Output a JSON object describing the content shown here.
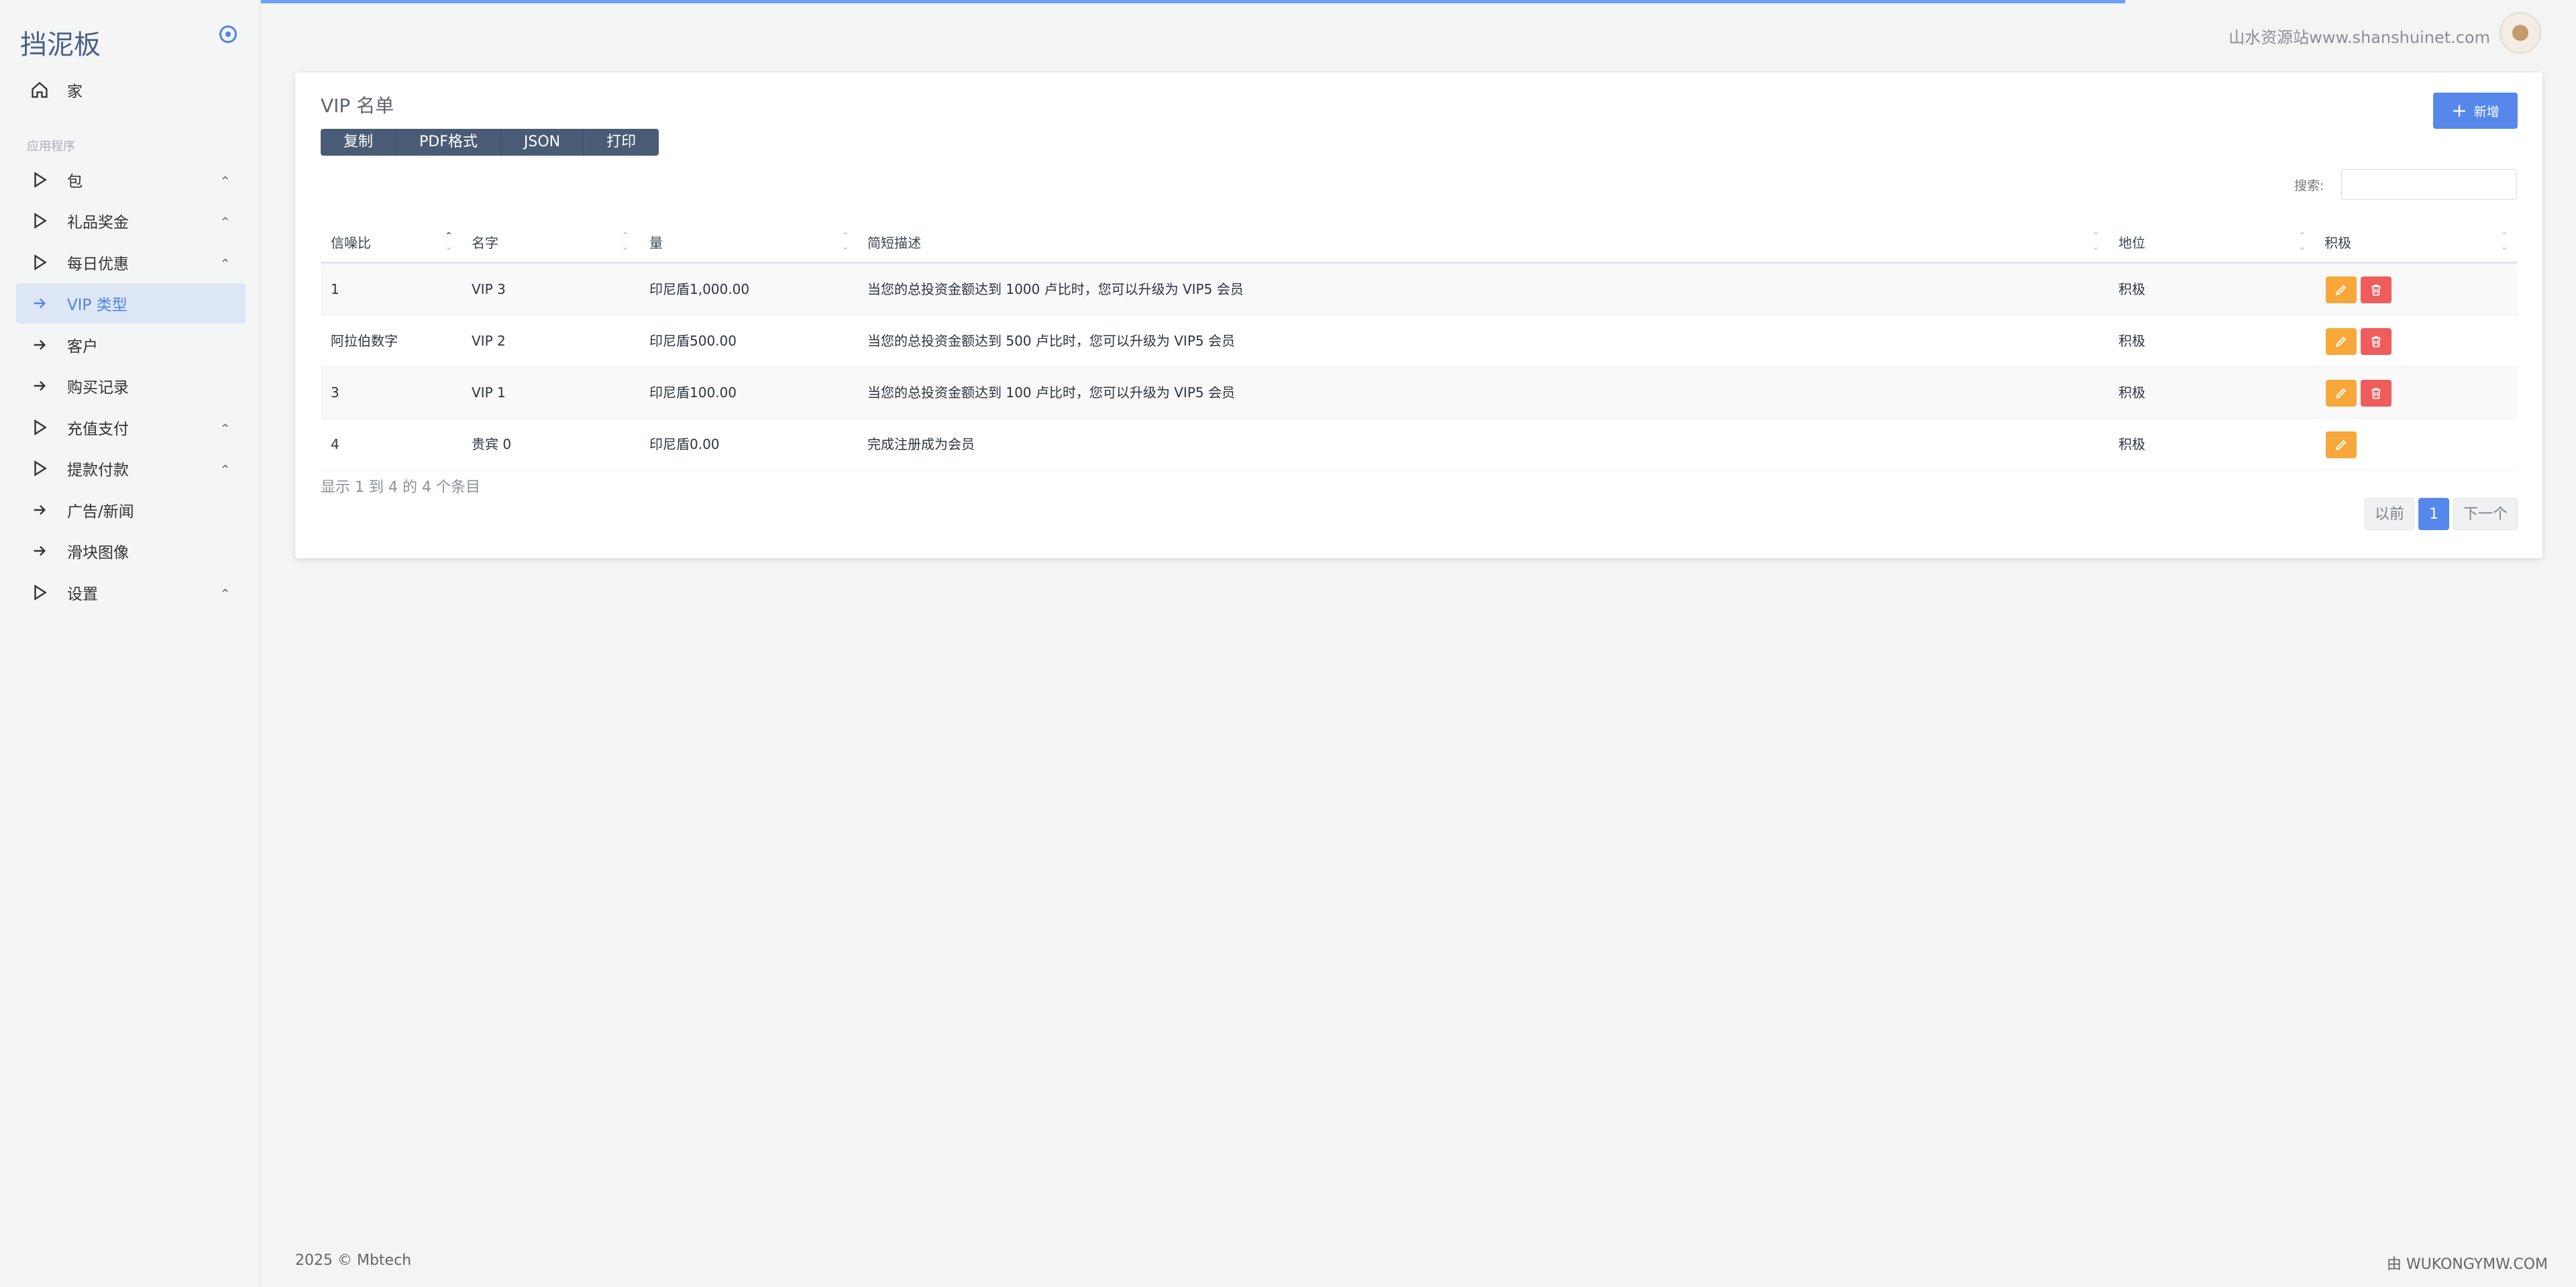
{
  "brand": "挡泥板",
  "sidebar": {
    "section_label": "应用程序",
    "items": [
      {
        "label": "家",
        "icon": "home-icon"
      },
      {
        "label": "包",
        "icon": "play-icon",
        "chevron": true
      },
      {
        "label": "礼品奖金",
        "icon": "play-icon",
        "chevron": true
      },
      {
        "label": "每日优惠",
        "icon": "play-icon",
        "chevron": true
      },
      {
        "label": "VIP 类型",
        "icon": "arrow-right-icon",
        "active": true
      },
      {
        "label": "客户",
        "icon": "arrow-right-icon"
      },
      {
        "label": "购买记录",
        "icon": "arrow-right-icon"
      },
      {
        "label": "充值支付",
        "icon": "play-icon",
        "chevron": true
      },
      {
        "label": "提款付款",
        "icon": "play-icon",
        "chevron": true
      },
      {
        "label": "广告/新闻",
        "icon": "arrow-right-icon"
      },
      {
        "label": "滑块图像",
        "icon": "arrow-right-icon"
      },
      {
        "label": "设置",
        "icon": "play-icon",
        "chevron": true
      }
    ]
  },
  "header": {
    "site_name": "山水资源站www.shanshuinet.com",
    "progress": 0.825
  },
  "card": {
    "title": "VIP 名单",
    "export_buttons": [
      "复制",
      "PDF格式",
      "JSON",
      "打印"
    ],
    "add_label": "新增",
    "search_label": "搜索:",
    "search_value": ""
  },
  "table": {
    "columns": [
      "信噪比",
      "名字",
      "量",
      "简短描述",
      "地位",
      "积极"
    ],
    "rows": [
      {
        "id": "1",
        "name": "VIP 3",
        "amount": "印尼盾1,000.00",
        "desc": "当您的总投资金额达到 1000 卢比时，您可以升级为 VIP5 会员",
        "status": "积极",
        "deletable": true
      },
      {
        "id": "阿拉伯数字",
        "name": "VIP 2",
        "amount": "印尼盾500.00",
        "desc": "当您的总投资金额达到 500 卢比时，您可以升级为 VIP5 会员",
        "status": "积极",
        "deletable": true
      },
      {
        "id": "3",
        "name": "VIP 1",
        "amount": "印尼盾100.00",
        "desc": "当您的总投资金额达到 100 卢比时，您可以升级为 VIP5 会员",
        "status": "积极",
        "deletable": true
      },
      {
        "id": "4",
        "name": "贵宾 0",
        "amount": "印尼盾0.00",
        "desc": "完成注册成为会员",
        "status": "积极",
        "deletable": false
      }
    ]
  },
  "pagination": {
    "info": "显示 1 到 4 的 4 个条目",
    "prev": "以前",
    "current": "1",
    "next": "下一个"
  },
  "footer": {
    "left": "2025 © Mbtech",
    "right": "由 WUKONGYMW.COM"
  },
  "colors": {
    "accent": "#5588ea",
    "edit": "#f8a83a",
    "delete": "#ef5c5c",
    "button_group": "#4a5c75"
  }
}
